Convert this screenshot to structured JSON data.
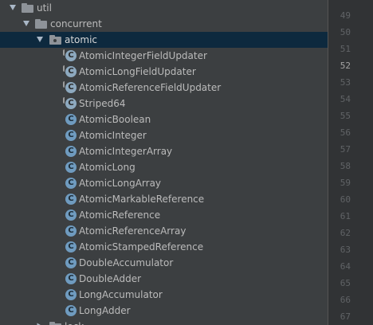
{
  "tree": {
    "nodes": [
      {
        "type": "folder",
        "label": "util",
        "expanded": true
      },
      {
        "type": "folder",
        "label": "concurrent",
        "expanded": true
      },
      {
        "type": "package",
        "label": "atomic",
        "expanded": true,
        "selected": true
      },
      {
        "type": "class",
        "label": "AtomicIntegerFieldUpdater",
        "abstract": true
      },
      {
        "type": "class",
        "label": "AtomicLongFieldUpdater",
        "abstract": true
      },
      {
        "type": "class",
        "label": "AtomicReferenceFieldUpdater",
        "abstract": true
      },
      {
        "type": "class",
        "label": "Striped64",
        "abstract": true
      },
      {
        "type": "class",
        "label": "AtomicBoolean"
      },
      {
        "type": "class",
        "label": "AtomicInteger"
      },
      {
        "type": "class",
        "label": "AtomicIntegerArray"
      },
      {
        "type": "class",
        "label": "AtomicLong"
      },
      {
        "type": "class",
        "label": "AtomicLongArray"
      },
      {
        "type": "class",
        "label": "AtomicMarkableReference"
      },
      {
        "type": "class",
        "label": "AtomicReference"
      },
      {
        "type": "class",
        "label": "AtomicReferenceArray"
      },
      {
        "type": "class",
        "label": "AtomicStampedReference"
      },
      {
        "type": "class",
        "label": "DoubleAccumulator"
      },
      {
        "type": "class",
        "label": "DoubleAdder"
      },
      {
        "type": "class",
        "label": "LongAccumulator"
      },
      {
        "type": "class",
        "label": "LongAdder"
      },
      {
        "type": "folder",
        "label": "lock",
        "expanded": false
      }
    ],
    "class_icon_letter": "C"
  },
  "gutter": {
    "line_numbers": [
      "49",
      "50",
      "51",
      "52",
      "53",
      "54",
      "55",
      "56",
      "57",
      "58",
      "59",
      "60",
      "61",
      "62",
      "63",
      "64",
      "65",
      "66",
      "67"
    ],
    "current_line": "52"
  }
}
